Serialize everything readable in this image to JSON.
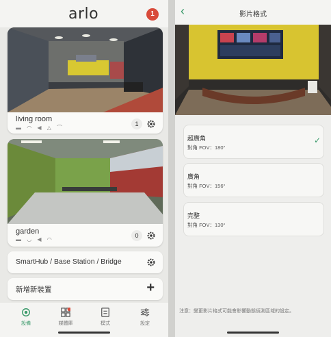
{
  "left": {
    "logo": "arlo",
    "alert_count": "1",
    "cameras": [
      {
        "name": "living room",
        "count": "1",
        "status_icons": "▬ ◠ ◀ △ ⌒"
      },
      {
        "name": "garden",
        "count": "0",
        "status_icons": "▬ ◡ ◀ ◠"
      }
    ],
    "rows": [
      {
        "label": "SmartHub / Base Station / Bridge"
      },
      {
        "label": "新增新裝置"
      }
    ],
    "tabs": [
      {
        "label": "設備",
        "icon": "device-icon",
        "active": true
      },
      {
        "label": "媒體庫",
        "icon": "library-icon",
        "active": false
      },
      {
        "label": "模式",
        "icon": "mode-icon",
        "active": false
      },
      {
        "label": "設定",
        "icon": "settings-icon",
        "active": false
      }
    ],
    "plus_symbol": "+"
  },
  "right": {
    "title": "影片格式",
    "back_symbol": "‹",
    "options": [
      {
        "title": "超廣角",
        "sub": "對角 FOV：180°",
        "selected": true
      },
      {
        "title": "廣角",
        "sub": "對角 FOV：156°",
        "selected": false
      },
      {
        "title": "完整",
        "sub": "對角 FOV：130°",
        "selected": false
      }
    ],
    "check_symbol": "✓",
    "note": "注意：變更影片格式可能會影響動態偵測區域的設定。"
  },
  "colors": {
    "accent": "#3b9a6b",
    "alert": "#d84a3a"
  }
}
